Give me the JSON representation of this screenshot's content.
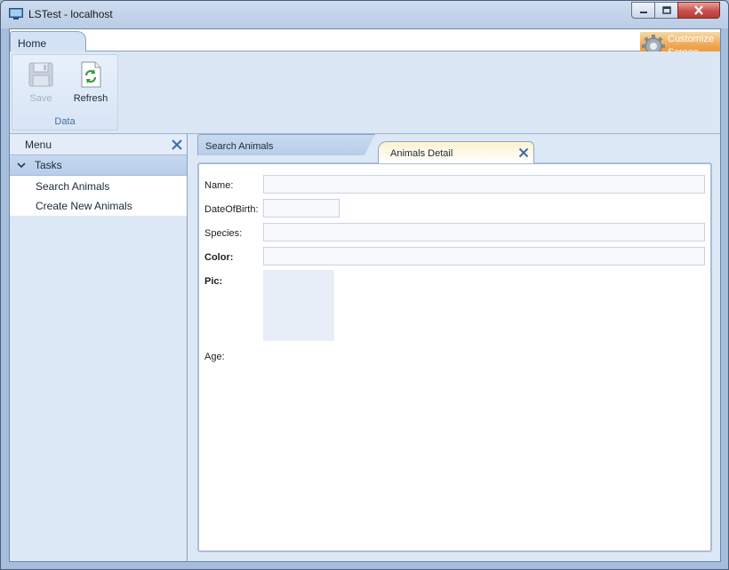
{
  "window": {
    "title": "LSTest - localhost"
  },
  "ribbon": {
    "tab": "Home",
    "customize": {
      "line1": "Customize",
      "line2": "Screen"
    },
    "group_label": "Data",
    "buttons": {
      "save": "Save",
      "refresh": "Refresh"
    }
  },
  "menu": {
    "header": "Menu",
    "section": "Tasks",
    "items": [
      "Search Animals",
      "Create New Animals"
    ]
  },
  "screens": {
    "tabs": [
      {
        "label": "Search Animals",
        "active": false
      },
      {
        "label": "Animals Detail",
        "active": true
      }
    ]
  },
  "detail": {
    "fields": [
      {
        "label": "Name:",
        "value": "",
        "bold": false
      },
      {
        "label": "DateOfBirth:",
        "value": "",
        "bold": false
      },
      {
        "label": "Species:",
        "value": "",
        "bold": false
      },
      {
        "label": "Color:",
        "value": "",
        "bold": true
      },
      {
        "label": "Pic:",
        "value": "",
        "bold": true
      },
      {
        "label": "Age:",
        "value": "",
        "bold": false
      }
    ]
  },
  "colors": {
    "accent": "#e98f2a",
    "active_tab": "#fdf2cf",
    "close_button": "#c75050"
  }
}
